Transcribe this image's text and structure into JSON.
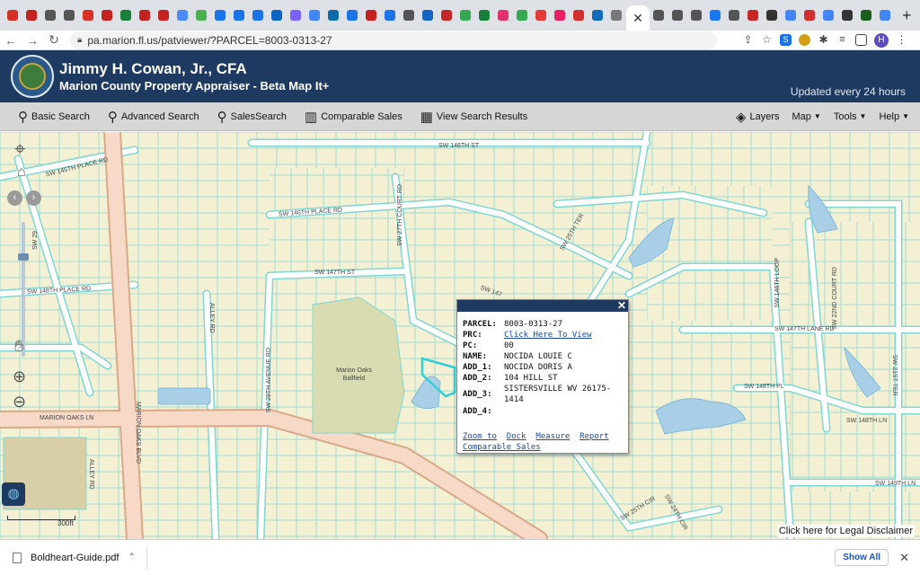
{
  "browser": {
    "tabs_favicon_colors": [
      "#d93025",
      "#c5221f",
      "#555",
      "#555",
      "#d93025",
      "#c5221f",
      "#188038",
      "#c5221f",
      "#c5221f",
      "#4c8bf5",
      "#4caf50",
      "#1a73e8",
      "#1a73e8",
      "#1a73e8",
      "#0a66c2",
      "#7b61ff",
      "#4285f4",
      "#0d6bab",
      "#1a73e8",
      "#c5221f",
      "#1a73e8",
      "#555",
      "#1565c0",
      "#c62828",
      "#34a853",
      "#188038",
      "#e1306c",
      "#34a853",
      "#e53935",
      "#e91e63",
      "#d32f2f",
      "#0f6cbd",
      "#777"
    ],
    "active_tab_close": "✕",
    "right_tab_colors": [
      "#555",
      "#555",
      "#555",
      "#1877f2",
      "#555",
      "#c62828",
      "#333",
      "#4285f4",
      "#d32f2f",
      "#4285f4",
      "#333",
      "#1b5e20",
      "#4285f4"
    ],
    "new_tab": "+",
    "tab_menu": "⌄",
    "url": "pa.marion.fl.us/patviewer/?PARCEL=8003-0313-27",
    "avatar": "H"
  },
  "header": {
    "appraiser_name": "Jimmy H. Cowan, Jr., CFA",
    "subtitle": "Marion County Property Appraiser - Beta Map It+",
    "updated": "Updated every 24 hours"
  },
  "toolbar": {
    "basic_search": "Basic Search",
    "advanced_search": "Advanced Search",
    "sales_search": "SalesSearch",
    "comparable_sales": "Comparable Sales",
    "view_results": "View Search Results",
    "layers": "Layers",
    "map": "Map",
    "tools": "Tools",
    "help": "Help"
  },
  "map": {
    "road_labels": {
      "sw146th_st": "SW 146TH ST",
      "sw145th_place_rd": "SW 145TH PLACE RD",
      "sw146th_place_rd": "SW 146TH PLACE RD",
      "sw147th_st": "SW 147TH ST",
      "sw148th_place_rd": "SW 148TH PLACE RD",
      "sw27th_court_rd": "SW 27TH COURT RD",
      "sw25th_ter": "SW 25TH TER",
      "alley_rd": "ALLEY RD",
      "sw29th_avenue_rd": "SW 29TH AVENUE RD",
      "marion_oaks_ln": "MARION OAKS LN",
      "marion_oaks_blvd": "MARION OAKS BLVD",
      "alley_rd_2": "ALLEY RD",
      "sw146th_loop": "SW 146TH LOOP",
      "sw22nd_court_rd": "SW 22ND COURT RD",
      "sw147th_lane_rd": "SW 147TH LANE RD",
      "sw21st_ter": "SW 21ST TER",
      "sw148th_pl": "SW 148TH PL",
      "sw148th_ln": "SW 148TH LN",
      "sw149th_ln": "SW 149TH LN",
      "sw25th_cir": "SW 25TH CIR",
      "sw24th_cir": "SW 24TH CIR",
      "sw147": "SW 147",
      "sw29": "SW 29",
      "ballfield": "Marion Oaks Ballfield"
    },
    "scale": "300ft",
    "disclaimer": "Click here for Legal Disclaimer"
  },
  "popup": {
    "close": "✕",
    "rows": [
      {
        "key": "PARCEL:",
        "value": "8003-0313-27"
      },
      {
        "key": "PRC:",
        "value": "Click Here To View"
      },
      {
        "key": "PC:",
        "value": "00"
      },
      {
        "key": "NAME:",
        "value": "NOCIDA LOUIE C"
      },
      {
        "key": "ADD_1:",
        "value": "NOCIDA DORIS A"
      },
      {
        "key": "ADD_2:",
        "value": "104 HILL ST"
      },
      {
        "key": "ADD_3:",
        "value": "SISTERSVILLE WV 26175-"
      },
      {
        "key": "",
        "value": "1414"
      },
      {
        "key": "ADD_4:",
        "value": ""
      }
    ],
    "links": {
      "zoom_to": "Zoom to",
      "dock": "Dock",
      "measure": "Measure",
      "report": "Report",
      "comparable": "Comparable Sales"
    }
  },
  "downloads": {
    "file": "Boldheart-Guide.pdf",
    "show_all": "Show All",
    "close": "✕"
  }
}
